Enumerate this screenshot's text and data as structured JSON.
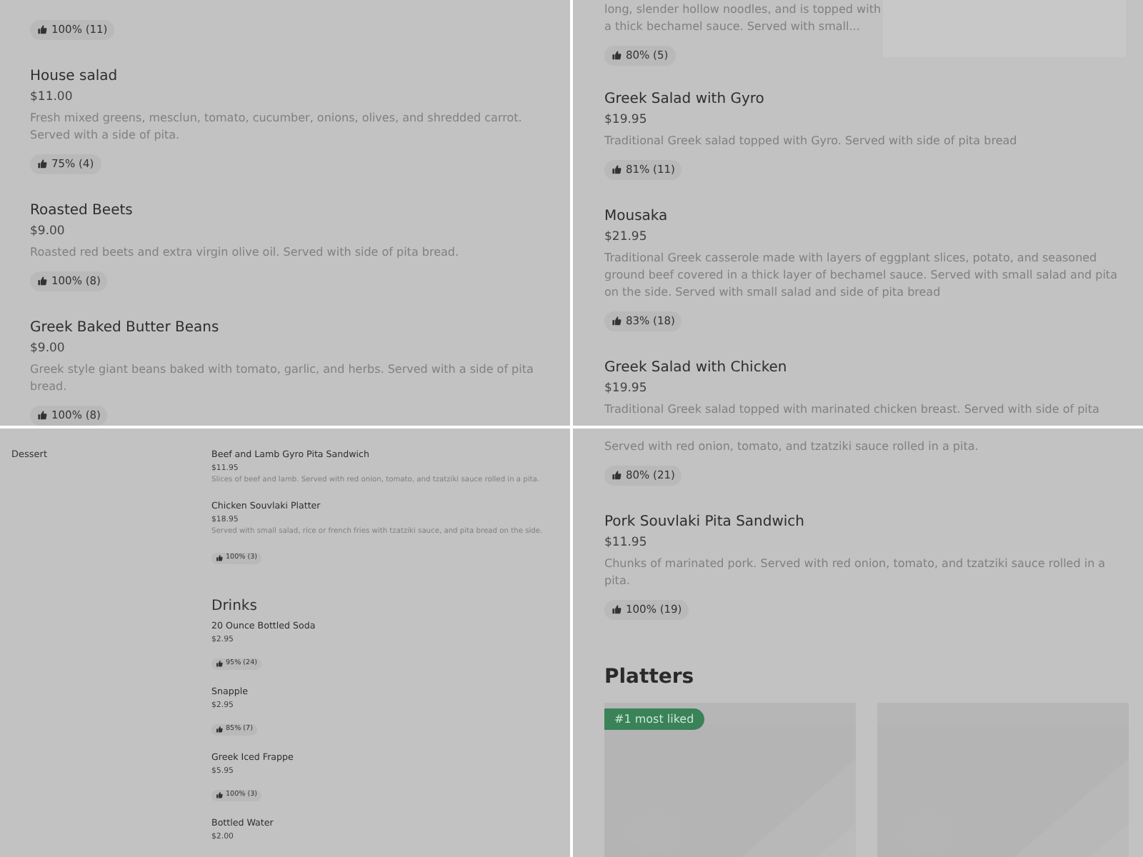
{
  "quadrant_1": {
    "items": [
      {
        "rating": "100% (11)"
      },
      {
        "name": "House salad",
        "price": "$11.00",
        "description": "Fresh mixed greens, mesclun, tomato, cucumber, onions, olives, and shredded carrot. Served with a side of pita.",
        "rating": "75% (4)"
      },
      {
        "name": "Roasted Beets",
        "price": "$9.00",
        "description": "Roasted red beets and extra virgin olive oil. Served with side of pita bread.",
        "rating": "100% (8)"
      },
      {
        "name": "Greek Baked Butter Beans",
        "price": "$9.00",
        "description": "Greek style giant beans baked with tomato, garlic, and herbs. Served with a side of pita bread.",
        "rating": "100% (8)"
      }
    ]
  },
  "quadrant_2": {
    "first_item": {
      "description": "long, slender hollow noodles, and is topped with a thick bechamel sauce. Served with small...",
      "rating": "80% (5)",
      "kind": "picture"
    },
    "items": [
      {
        "name": "Greek Salad with Gyro",
        "price": "$19.95",
        "description": "Traditional Greek salad topped with Gyro. Served with side of pita bread",
        "rating": "81% (11)"
      },
      {
        "name": "Mousaka",
        "price": "$21.95",
        "description": "Traditional Greek casserole made with layers of eggplant slices, potato, and seasoned ground beef covered in a thick layer of bechamel sauce. Served with small salad and pita on the side. Served with small salad and side of pita bread",
        "rating": "83% (18)"
      },
      {
        "name": "Greek Salad with Chicken",
        "price": "$19.95",
        "description": "Traditional Greek salad topped with marinated chicken breast. Served with side of pita"
      }
    ]
  },
  "quadrant_3": {
    "sidebar": {
      "items": [
        {
          "label": "Dessert"
        }
      ]
    },
    "sections": [
      {
        "items": [
          {
            "name": "Beef and Lamb Gyro Pita Sandwich",
            "price": "$11.95",
            "description": "Slices of beef and lamb. Served with red onion, tomato, and tzatziki sauce rolled in a pita."
          },
          {
            "name": "Chicken Souvlaki Platter",
            "price": "$18.95",
            "description": "Served with small salad, rice or french fries with tzatziki sauce, and pita bread on the side.",
            "rating": "100% (3)"
          }
        ]
      },
      {
        "title": "Drinks",
        "items": [
          {
            "name": "20 Ounce Bottled Soda",
            "price": "$2.95",
            "rating": "95% (24)"
          },
          {
            "name": "Snapple",
            "price": "$2.95",
            "rating": "85% (7)"
          },
          {
            "name": "Greek Iced Frappe",
            "price": "$5.95",
            "rating": "100% (3)"
          },
          {
            "name": "Bottled Water",
            "price": "$2.00"
          }
        ]
      }
    ]
  },
  "quadrant_4": {
    "items": [
      {
        "description": "Served with red onion, tomato, and tzatziki sauce rolled in a pita.",
        "rating": "80% (21)"
      },
      {
        "name": "Pork Souvlaki Pita Sandwich",
        "price": "$11.95",
        "description": "Chunks of marinated pork. Served with red onion, tomato, and tzatziki sauce rolled in a pita.",
        "rating": "100% (19)"
      }
    ],
    "section_title": "Platters",
    "cards": [
      {
        "kind": "picture",
        "badge": "#1 most liked"
      },
      {
        "kind": "picture"
      }
    ]
  }
}
